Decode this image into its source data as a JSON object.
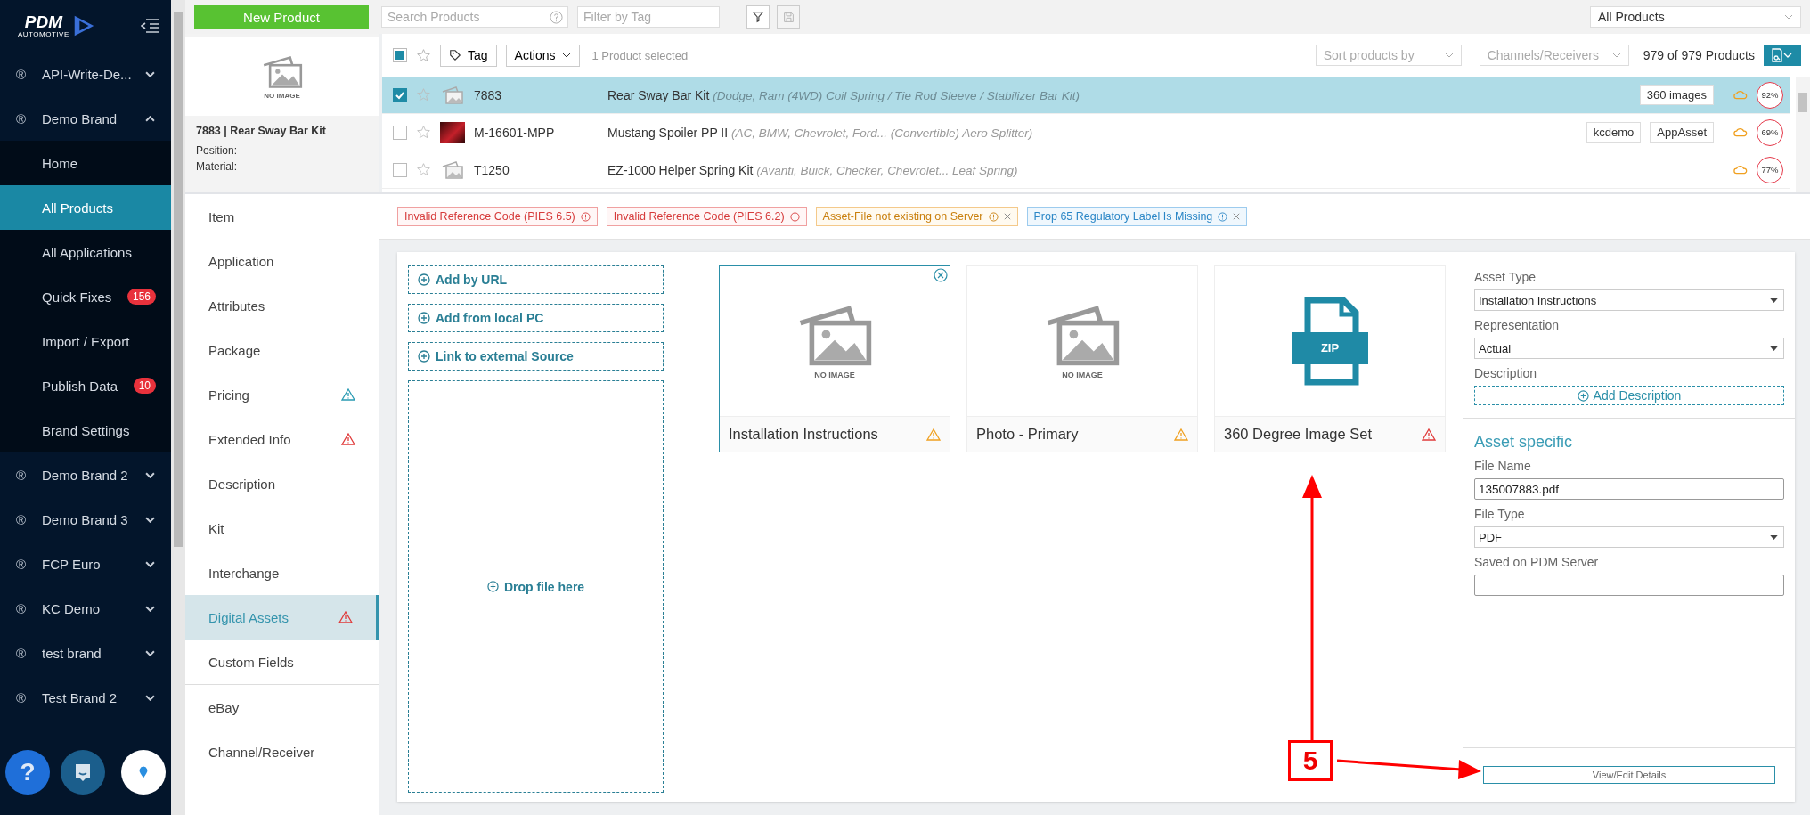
{
  "logo": {
    "name": "PDM",
    "tagline": "AUTOMOTIVE"
  },
  "sidebar": {
    "brands": [
      {
        "mark": "®",
        "label": "API-Write-De...",
        "expanded": false
      },
      {
        "mark": "®",
        "label": "Demo Brand",
        "expanded": true,
        "children": [
          {
            "label": "Home",
            "selected": false
          },
          {
            "label": "All Products",
            "selected": true
          },
          {
            "label": "All Applications",
            "selected": false
          },
          {
            "label": "Quick Fixes",
            "selected": false,
            "badge": "156"
          },
          {
            "label": "Import / Export",
            "selected": false
          },
          {
            "label": "Publish Data",
            "selected": false,
            "badge": "10"
          },
          {
            "label": "Brand Settings",
            "selected": false
          }
        ]
      },
      {
        "mark": "®",
        "label": "Demo Brand 2",
        "expanded": false
      },
      {
        "mark": "®",
        "label": "Demo Brand 3",
        "expanded": false
      },
      {
        "mark": "®",
        "label": "FCP Euro",
        "expanded": false
      },
      {
        "mark": "®",
        "label": "KC Demo",
        "expanded": false
      },
      {
        "mark": "®",
        "label": "test brand",
        "expanded": false
      },
      {
        "mark": "®",
        "label": "Test Brand 2",
        "expanded": false
      }
    ],
    "help_label": "?"
  },
  "toolbar": {
    "new_button": "New Product",
    "search": {
      "placeholder": "Search Products"
    },
    "tag_filter": {
      "placeholder": "Filter by Tag"
    },
    "scope": "All Products"
  },
  "preview": {
    "thumb_text": "NO IMAGE",
    "title": "7883 | Rear Sway Bar Kit",
    "fields": [
      "Position:",
      "Material:"
    ]
  },
  "product_list": {
    "indeterminate": true,
    "tag_button": "Tag",
    "actions": "Actions",
    "selection": "1 Product selected",
    "sort": {
      "placeholder": "Sort products by"
    },
    "channels": {
      "placeholder": "Channels/Receivers"
    },
    "count": "979 of 979 Products",
    "rows": [
      {
        "selected": true,
        "starred": false,
        "kind": "icon",
        "sku": "7883",
        "name": "Rear Sway Bar Kit",
        "fitment": "(Dodge, Ram (4WD) Coil Spring / Tie Rod Sleeve / Stabilizer Bar Kit)",
        "tags": [
          "360 images"
        ],
        "percent": "92%"
      },
      {
        "selected": false,
        "starred": false,
        "kind": "photo",
        "sku": "M-16601-MPP",
        "name": "Mustang Spoiler PP II",
        "fitment": "(AC, BMW, Chevrolet, Ford... (Convertible) Aero Splitter)",
        "tags": [
          "kcdemo",
          "AppAsset"
        ],
        "percent": "69%"
      },
      {
        "selected": false,
        "starred": false,
        "kind": "icon",
        "sku": "T1250",
        "name": "EZ-1000 Helper Spring Kit",
        "fitment": "(Avanti, Buick, Checker, Chevrolet... Leaf Spring)",
        "tags": [],
        "percent": "77%"
      }
    ]
  },
  "tabs": [
    {
      "label": "Item",
      "selected": false
    },
    {
      "label": "Application",
      "selected": false
    },
    {
      "label": "Attributes",
      "selected": false
    },
    {
      "label": "Package",
      "selected": false
    },
    {
      "label": "Pricing",
      "selected": false,
      "color": "#2a9bb3"
    },
    {
      "label": "Extended Info",
      "selected": false,
      "color": "#e03a3a"
    },
    {
      "label": "Description",
      "selected": false
    },
    {
      "label": "Kit",
      "selected": false
    },
    {
      "label": "Interchange",
      "selected": false
    },
    {
      "label": "Digital Assets",
      "selected": true,
      "color": "#e03a3a"
    },
    {
      "label": "Custom Fields",
      "selected": false
    }
  ],
  "tabs_secondary": [
    {
      "label": "eBay",
      "selected": false
    },
    {
      "label": "Channel/Receiver",
      "selected": false
    }
  ],
  "issues": [
    {
      "kind": "error",
      "text": "Invalid Reference Code (PIES 6.5)",
      "closable": false
    },
    {
      "kind": "error",
      "text": "Invalid Reference Code (PIES 6.2)",
      "closable": false
    },
    {
      "kind": "warning",
      "text": "Asset-File not existing on Server",
      "closable": true
    },
    {
      "kind": "info",
      "text": "Prop 65 Regulatory Label Is Missing",
      "closable": true
    }
  ],
  "asset_actions": [
    "Add by URL",
    "Add from local PC",
    "Link to external Source"
  ],
  "drop_zone": "Drop file here",
  "assets": [
    {
      "kind": "no-image",
      "thumb_text": "NO IMAGE",
      "title": "Installation Instructions",
      "selected": true,
      "color": "#f0a020"
    },
    {
      "kind": "no-image",
      "thumb_text": "NO IMAGE",
      "title": "Photo - Primary",
      "selected": false,
      "color": "#f0a020"
    },
    {
      "kind": "zip",
      "thumb_text": "ZIP",
      "title": "360 Degree Image Set",
      "selected": false,
      "color": "#e03a3a"
    }
  ],
  "details": {
    "asset_type": {
      "label": "Asset Type",
      "value": "Installation Instructions"
    },
    "representation": {
      "label": "Representation",
      "value": "Actual"
    },
    "description": {
      "label": "Description",
      "button": "Add Description"
    },
    "section": "Asset specific",
    "file_name": {
      "label": "File Name",
      "value": "135007883.pdf"
    },
    "file_type": {
      "label": "File Type",
      "value": "PDF"
    },
    "saved": {
      "label": "Saved on PDM Server"
    },
    "view_button": "View/Edit Details"
  },
  "annotation": {
    "label": "5"
  }
}
